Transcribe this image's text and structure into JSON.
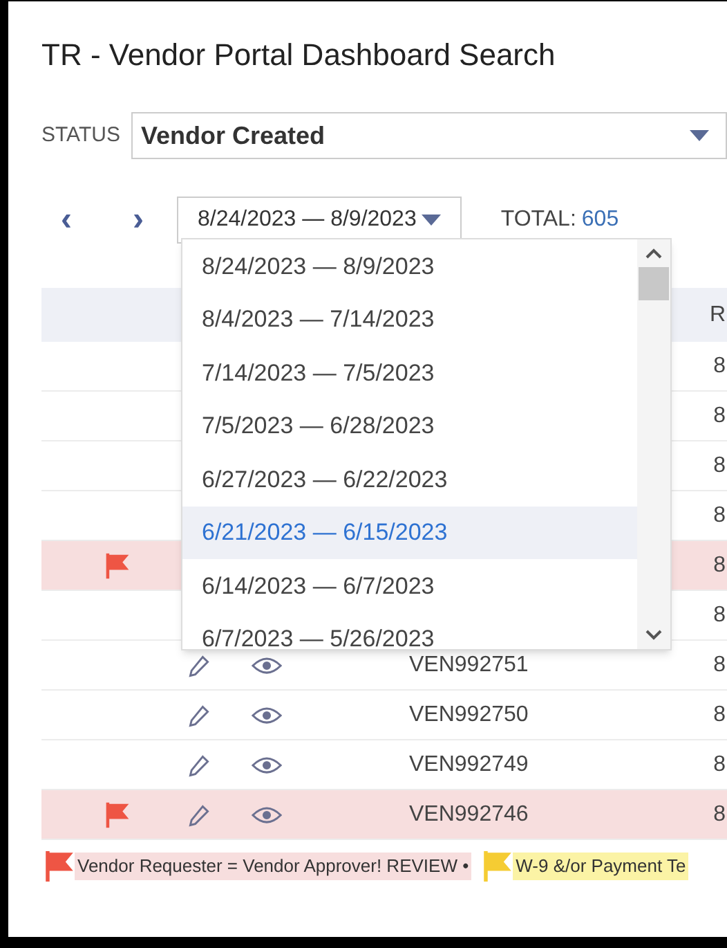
{
  "title": "TR - Vendor Portal Dashboard Search",
  "status": {
    "label": "STATUS",
    "value": "Vendor Created"
  },
  "nav": {
    "prev": "‹",
    "next": "›",
    "range": "8/24/2023 — 8/9/2023",
    "total_label": "TOTAL:",
    "total": "605"
  },
  "table": {
    "column_6": "R",
    "rows": [
      {
        "flagged": false,
        "column_6": "8"
      },
      {
        "flagged": false,
        "column_6": "8"
      },
      {
        "flagged": false,
        "column_6": "8"
      },
      {
        "flagged": false,
        "column_6": "8"
      },
      {
        "flagged": true,
        "column_6": "8"
      },
      {
        "flagged": false,
        "column_6": "8"
      },
      {
        "flagged": false,
        "id": "VEN992751",
        "column_6": "8"
      },
      {
        "flagged": false,
        "id": "VEN992750",
        "column_6": "8"
      },
      {
        "flagged": false,
        "id": "VEN992749",
        "column_6": "8"
      },
      {
        "flagged": true,
        "id": "VEN992746",
        "column_6": "8"
      }
    ]
  },
  "range_menu": [
    {
      "label": "8/24/2023 — 8/9/2023",
      "highlighted": false
    },
    {
      "label": "8/4/2023 — 7/14/2023",
      "highlighted": false
    },
    {
      "label": "7/14/2023 — 7/5/2023",
      "highlighted": false
    },
    {
      "label": "7/5/2023 — 6/28/2023",
      "highlighted": false
    },
    {
      "label": "6/27/2023 — 6/22/2023",
      "highlighted": false
    },
    {
      "label": "6/21/2023 — 6/15/2023",
      "highlighted": true
    },
    {
      "label": "6/14/2023 — 6/7/2023",
      "highlighted": false
    },
    {
      "label": "6/7/2023 — 5/26/2023",
      "highlighted": false
    }
  ],
  "legend": [
    {
      "kind": "red",
      "text": "Vendor Requester = Vendor Approver! REVIEW •"
    },
    {
      "kind": "yellow",
      "text": "W-9 &/or Payment Te"
    }
  ]
}
